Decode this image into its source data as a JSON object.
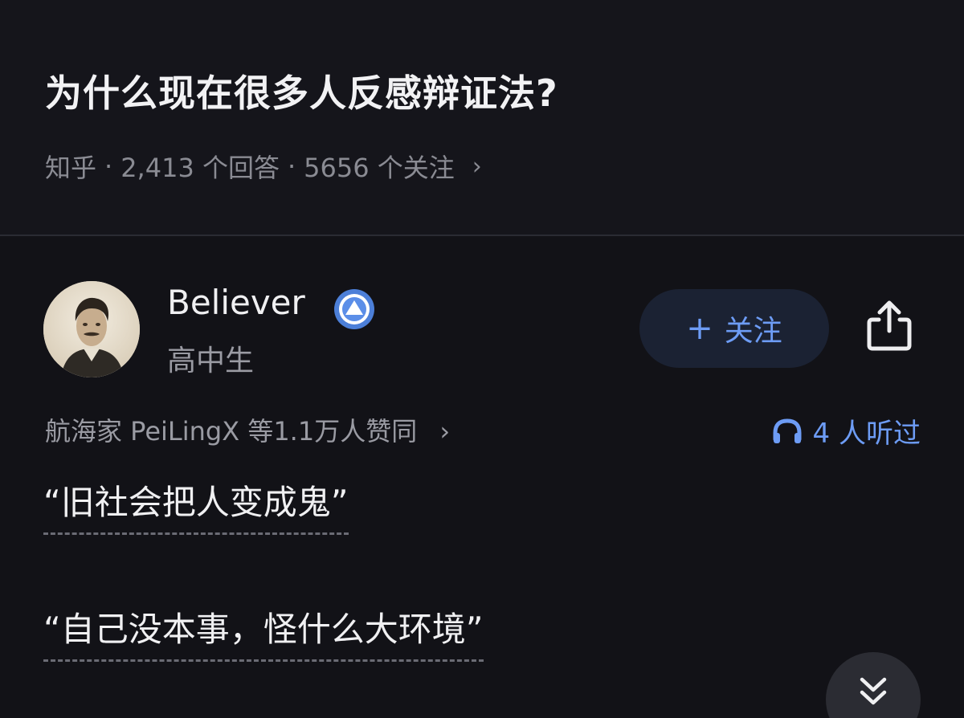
{
  "question": {
    "title": "为什么现在很多人反感辩证法?",
    "source": "知乎",
    "separator": "·",
    "answers": "2,413 个回答",
    "followers": "5656 个关注",
    "chevron": "›"
  },
  "answer": {
    "author": {
      "name": "Believer",
      "description": "高中生",
      "badge_icon": "verified-badge-icon",
      "avatar_icon": "avatar-portrait"
    },
    "follow_button": {
      "plus": "+",
      "label": "关注"
    },
    "share_icon": "share-icon",
    "upvote_text": "航海家 PeiLingX 等1.1万人赞同",
    "upvote_chevron": "›",
    "listen_text": "4 人听过",
    "listen_icon": "headphones-icon",
    "quotes": [
      "“旧社会把人变成鬼”",
      "“自己没本事，怪什么大环境”"
    ],
    "scroll_down_icon": "double-chevron-down-icon"
  },
  "colors": {
    "background": "#121217",
    "accent": "#6d9cf5",
    "text_primary": "#f0f0f2",
    "text_secondary": "#9a9ba3"
  }
}
